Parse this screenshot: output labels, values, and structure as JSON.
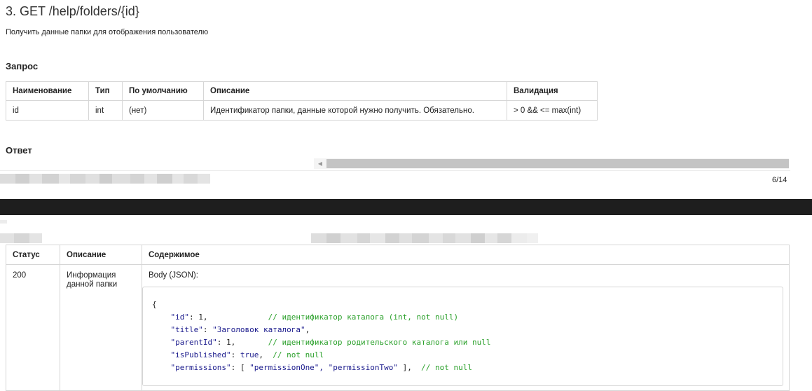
{
  "page1": {
    "title": "3. GET /help/folders/{id}",
    "description": "Получить данные папки для отображения пользователю",
    "request_heading": "Запрос",
    "request_table": {
      "headers": [
        "Наименование",
        "Тип",
        "По умолчанию",
        "Описание",
        "Валидация"
      ],
      "rows": [
        [
          "id",
          "int",
          "(нет)",
          "Идентификатор папки, данные которой нужно получить. Обязательно.",
          "> 0 && <= max(int)"
        ]
      ]
    },
    "response_heading": "Ответ",
    "scroll_arrow": "◀",
    "page_number": "6/14"
  },
  "page2": {
    "response_table": {
      "headers": [
        "Статус",
        "Описание",
        "Содержимое"
      ],
      "status": "200",
      "description": "Информация данной папки",
      "body_label": "Body (JSON):"
    },
    "code": {
      "open": "{",
      "lines": [
        {
          "key": "\"id\"",
          "rest": ": 1,",
          "pad": "             ",
          "value_kw": "",
          "after": "",
          "comment": "// идентификатор каталога (int, not null)"
        },
        {
          "key": "\"title\"",
          "rest": ": ",
          "pad": "",
          "value_str": "\"Заголовок каталога\"",
          "after": ",",
          "comment": ""
        },
        {
          "key": "\"parentId\"",
          "rest": ": 1,",
          "pad": "       ",
          "value_kw": "",
          "after": "",
          "comment": "// идентификатор родительского каталога или null"
        },
        {
          "key": "\"isPublished\"",
          "rest": ": ",
          "pad": "",
          "value_kw": "true",
          "after": ",  ",
          "comment": "// not null"
        },
        {
          "key": "\"permissions\"",
          "rest": ": [ ",
          "pad": "",
          "value_str": "\"permissionOne\", \"permissionTwo\"",
          "after": " ],  ",
          "comment": "// not null"
        }
      ]
    }
  },
  "colors": {
    "border": "#d6d6d6",
    "comment": "#2aa02a",
    "code_keyword": "#1a1a8c",
    "dark_band": "#1e1e1e"
  }
}
